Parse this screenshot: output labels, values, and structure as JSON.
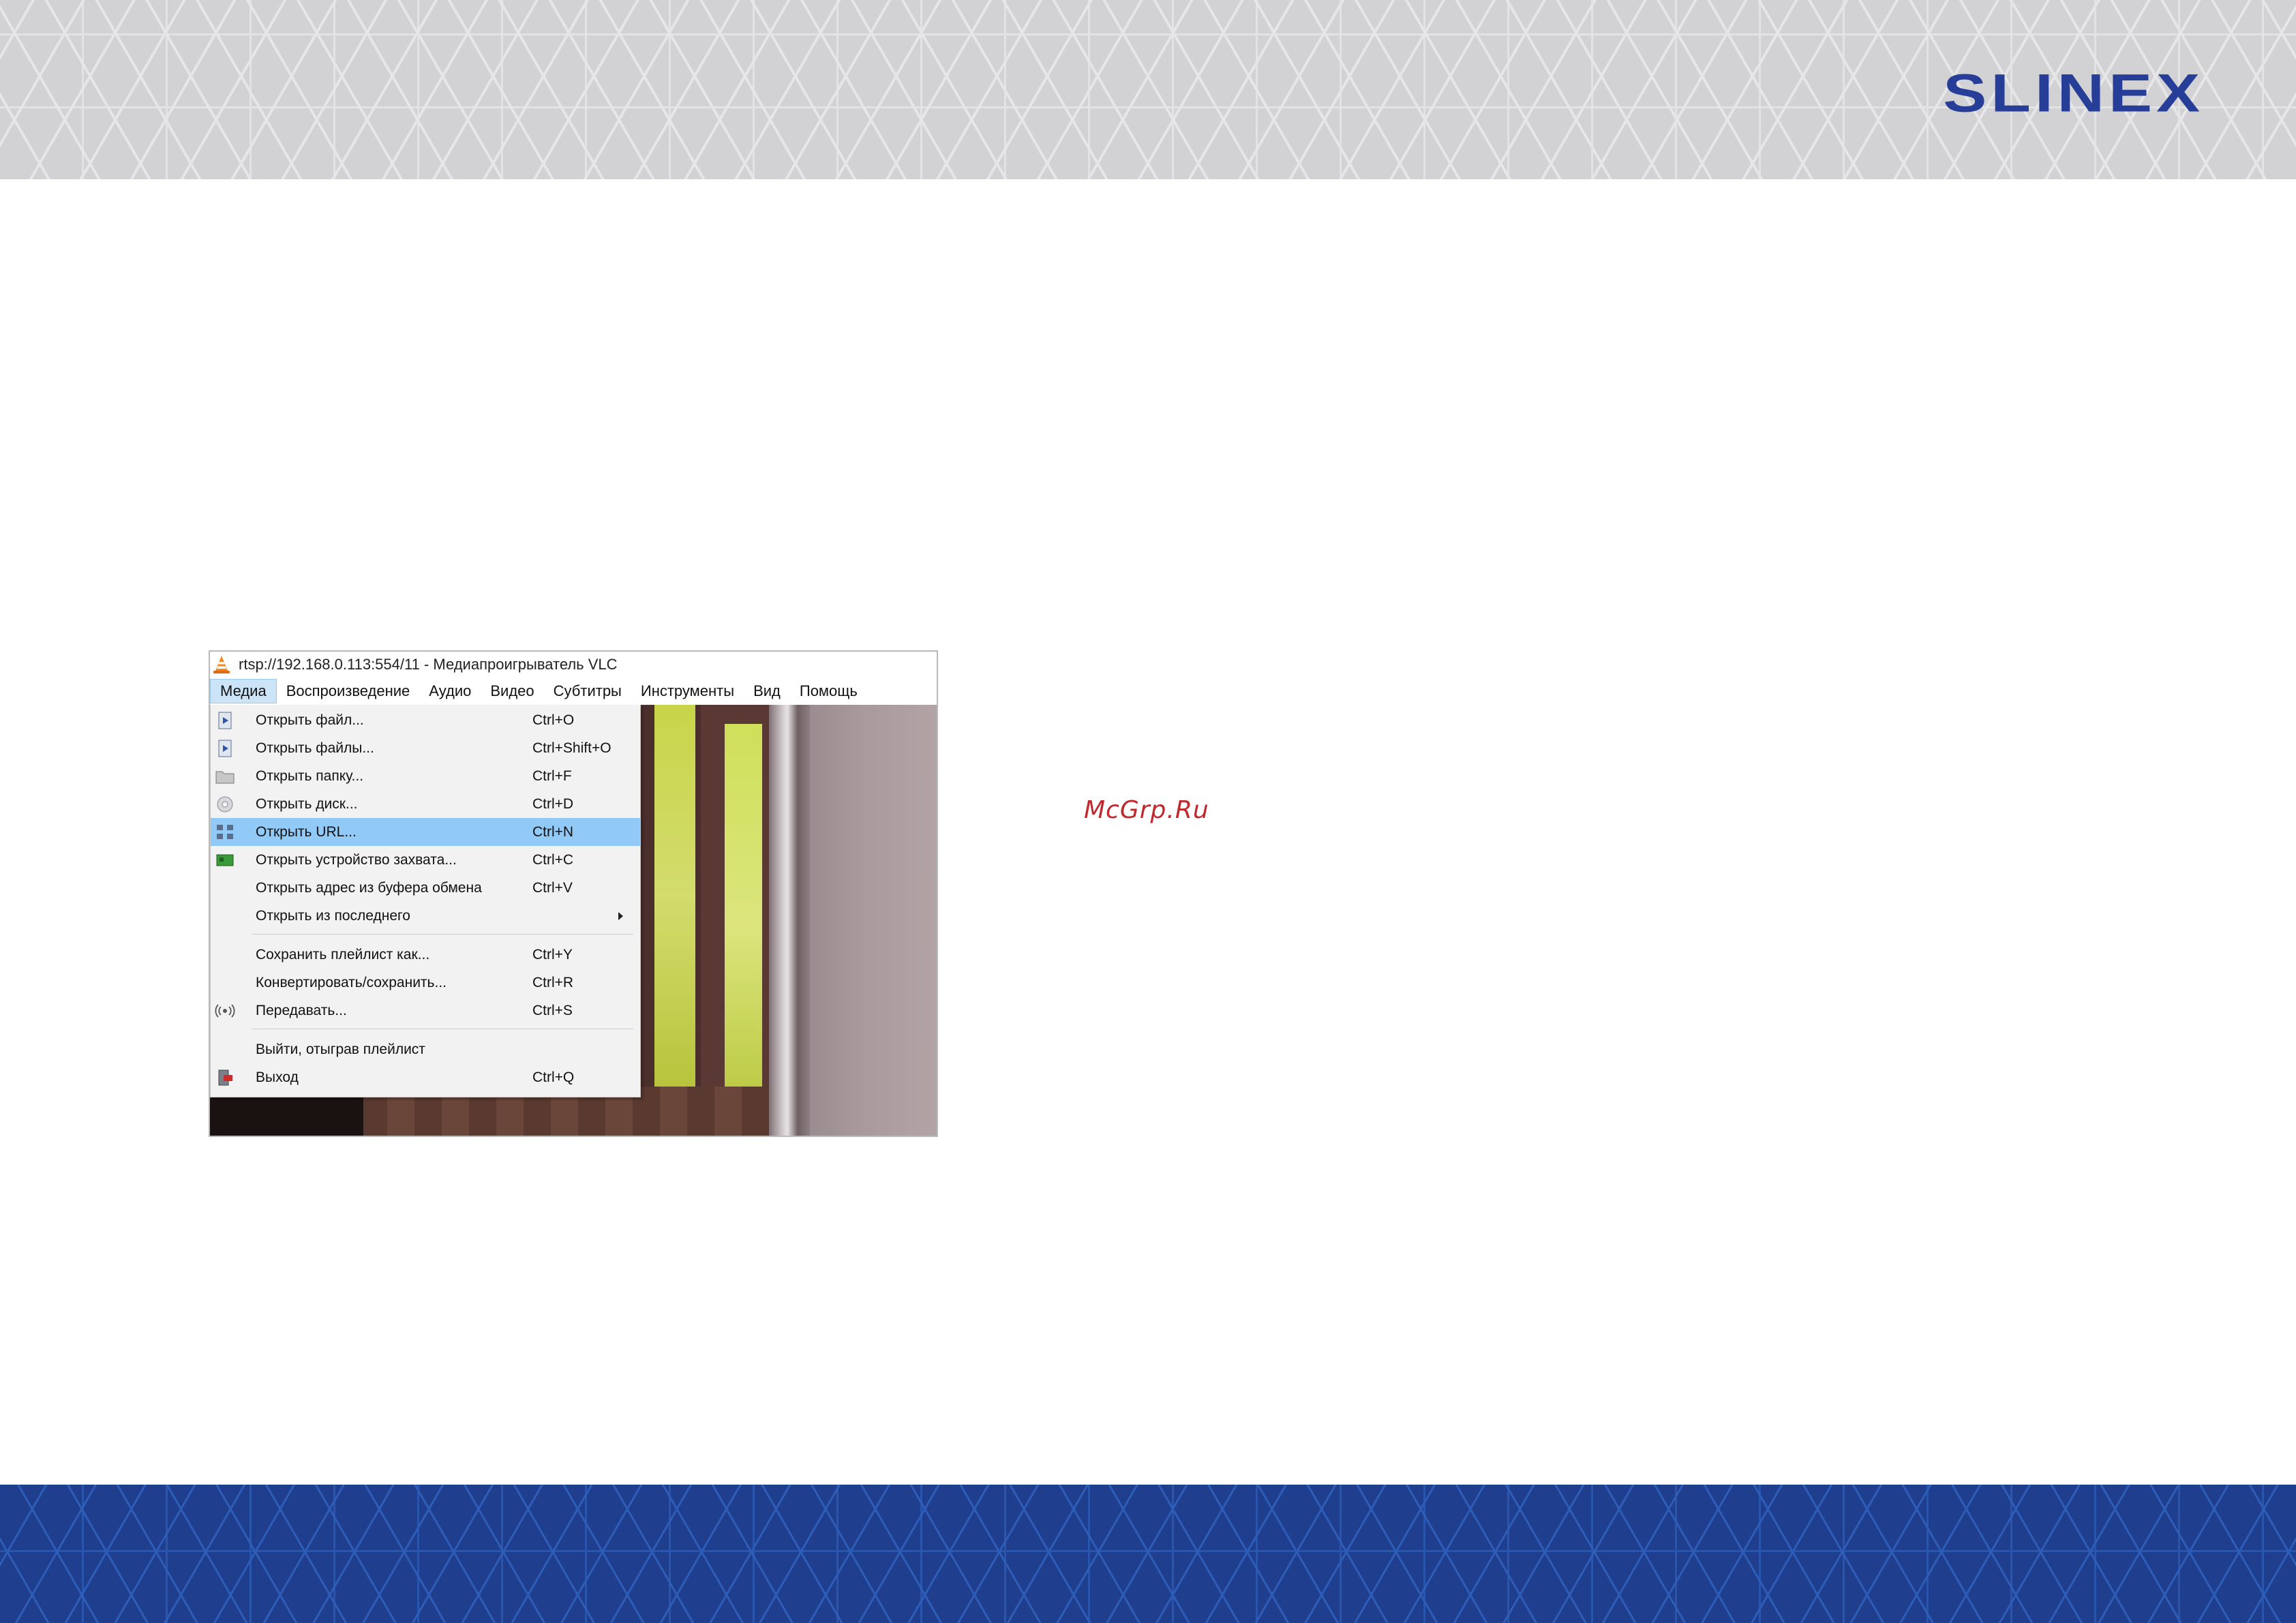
{
  "brand": {
    "logo_text": "SLINEX"
  },
  "watermark": "McGrp.Ru",
  "vlc": {
    "window_title": "rtsp://192.168.0.113:554/11 - Медиапроигрыватель VLC",
    "menu_bar": [
      "Медиа",
      "Воспроизведение",
      "Аудио",
      "Видео",
      "Субтитры",
      "Инструменты",
      "Вид",
      "Помощь"
    ],
    "active_menu": "Медиа",
    "media_menu": [
      {
        "label": "Открыть файл...",
        "shortcut": "Ctrl+O",
        "icon": "file-play-icon"
      },
      {
        "label": "Открыть файлы...",
        "shortcut": "Ctrl+Shift+O",
        "icon": "files-play-icon"
      },
      {
        "label": "Открыть папку...",
        "shortcut": "Ctrl+F",
        "icon": "folder-icon"
      },
      {
        "label": "Открыть диск...",
        "shortcut": "Ctrl+D",
        "icon": "disc-icon"
      },
      {
        "label": "Открыть URL...",
        "shortcut": "Ctrl+N",
        "icon": "network-icon",
        "highlighted": true
      },
      {
        "label": "Открыть устройство захвата...",
        "shortcut": "Ctrl+C",
        "icon": "capture-card-icon"
      },
      {
        "label": "Открыть адрес из буфера обмена",
        "shortcut": "Ctrl+V",
        "icon": ""
      },
      {
        "label": "Открыть из последнего",
        "shortcut": "",
        "icon": "",
        "submenu": true
      },
      {
        "label": "Сохранить плейлист как...",
        "shortcut": "Ctrl+Y",
        "icon": ""
      },
      {
        "label": "Конвертировать/сохранить...",
        "shortcut": "Ctrl+R",
        "icon": ""
      },
      {
        "label": "Передавать...",
        "shortcut": "Ctrl+S",
        "icon": "stream-icon"
      },
      {
        "label": "Выйти, отыграв плейлист",
        "shortcut": "",
        "icon": ""
      },
      {
        "label": "Выход",
        "shortcut": "Ctrl+Q",
        "icon": "exit-icon"
      }
    ]
  },
  "colors": {
    "brand_blue": "#263e97",
    "menu_highlight": "#91c9f7",
    "watermark_red": "#c0282d"
  }
}
